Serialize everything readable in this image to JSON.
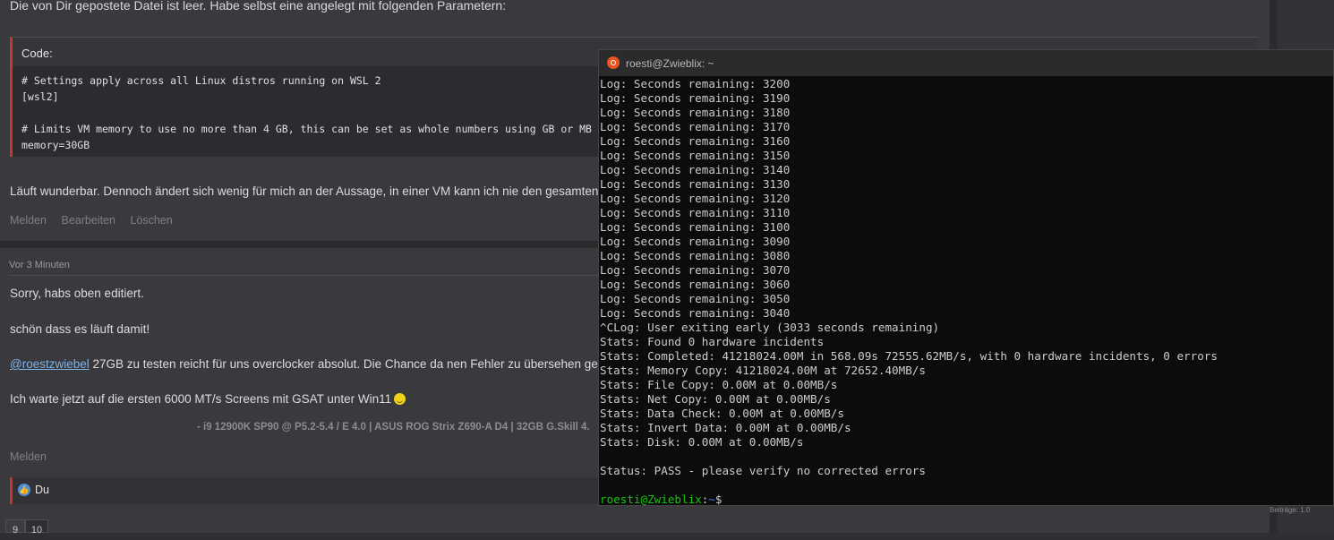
{
  "forum": {
    "intro_text": "Die von Dir gepostete Datei ist leer. Habe selbst eine angelegt mit folgenden Parametern:",
    "code_title": "Code:",
    "code_lines": [
      "# Settings apply across all Linux distros running on WSL 2",
      "[wsl2]",
      "",
      "# Limits VM memory to use no more than 4 GB, this can be set as whole numbers using GB or MB",
      "memory=30GB"
    ],
    "post1_text": "Läuft wunderbar. Dennoch ändert sich wenig für mich an der Aussage, in einer VM kann ich nie den gesamten",
    "actions": [
      "Melden",
      "Bearbeiten",
      "Löschen"
    ],
    "post2_time": "Vor 3 Minuten",
    "post2_line1": "Sorry, habs oben editiert.",
    "post2_line2": "schön dass es läuft damit!",
    "post2_mention": "@roestzwiebel",
    "post2_line3_rest": " 27GB zu testen reicht für uns overclocker absolut. Die Chance da nen Fehler zu übersehen ge",
    "post2_line4": "Ich warte jetzt auf die ersten 6000 MT/s Screens mit GSAT unter Win11",
    "signature": "- i9 12900K SP90 @ P5.2-5.4 / E 4.0 | ASUS ROG Strix Z690-A D4 | 32GB G.Skill 4.",
    "post2_action": "Melden",
    "like_text": "Du",
    "pager": [
      "9",
      "10"
    ],
    "side_text": "Beiträge: 1.0"
  },
  "terminal": {
    "title": "roesti@Zwieblix: ~",
    "lines": [
      "Log: Seconds remaining: 3200",
      "Log: Seconds remaining: 3190",
      "Log: Seconds remaining: 3180",
      "Log: Seconds remaining: 3170",
      "Log: Seconds remaining: 3160",
      "Log: Seconds remaining: 3150",
      "Log: Seconds remaining: 3140",
      "Log: Seconds remaining: 3130",
      "Log: Seconds remaining: 3120",
      "Log: Seconds remaining: 3110",
      "Log: Seconds remaining: 3100",
      "Log: Seconds remaining: 3090",
      "Log: Seconds remaining: 3080",
      "Log: Seconds remaining: 3070",
      "Log: Seconds remaining: 3060",
      "Log: Seconds remaining: 3050",
      "Log: Seconds remaining: 3040",
      "^CLog: User exiting early (3033 seconds remaining)",
      "Stats: Found 0 hardware incidents",
      "Stats: Completed: 41218024.00M in 568.09s 72555.62MB/s, with 0 hardware incidents, 0 errors",
      "Stats: Memory Copy: 41218024.00M at 72652.40MB/s",
      "Stats: File Copy: 0.00M at 0.00MB/s",
      "Stats: Net Copy: 0.00M at 0.00MB/s",
      "Stats: Data Check: 0.00M at 0.00MB/s",
      "Stats: Invert Data: 0.00M at 0.00MB/s",
      "Stats: Disk: 0.00M at 0.00MB/s",
      "",
      "Status: PASS - please verify no corrected errors",
      ""
    ],
    "prompt_user": "roesti@Zwieblix",
    "prompt_sep": ":",
    "prompt_path": "~",
    "prompt_symbol": "$"
  }
}
